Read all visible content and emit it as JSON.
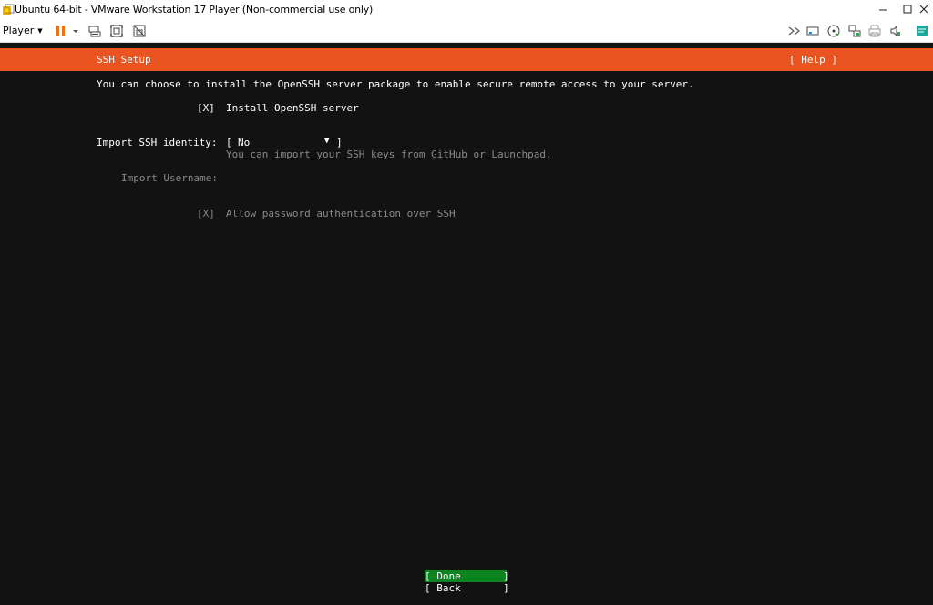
{
  "window": {
    "title": "Ubuntu 64-bit - VMware Workstation 17 Player (Non-commercial use only)",
    "minimize_icon": "minimize-icon",
    "maximize_icon": "maximize-icon",
    "close_icon": "close-icon"
  },
  "toolbar": {
    "player_label": "Player",
    "icons": [
      "pause-icon",
      "dropdown-icon",
      "send-ctrl-alt-del-icon",
      "fit-guest-icon",
      "unity-icon",
      "forward-icon",
      "removable-device-icon",
      "cd-dvd-icon",
      "network-icon",
      "printer-icon",
      "sound-icon",
      "message-log-icon"
    ]
  },
  "screen": {
    "header_title": "SSH Setup",
    "help_label": "[ Help ]",
    "description": "You can choose to install the OpenSSH server package to enable secure remote access to your server.",
    "install_checkbox": "[X]",
    "install_label": "Install OpenSSH server",
    "import_label": "Import SSH identity:",
    "import_select_open": "[",
    "import_value": "No",
    "import_arrow": "▼",
    "import_select_close": "]",
    "import_help": "You can import your SSH keys from GitHub or Launchpad.",
    "username_label": "Import Username:",
    "password_checkbox": "[X]",
    "password_label": "Allow password authentication over SSH",
    "done_button": "[ Done       ]",
    "back_button": "[ Back       ]"
  },
  "colors": {
    "header_orange": "#e95420",
    "done_green": "#0e8420",
    "background": "#121212",
    "disabled_text": "#8a8a8a"
  }
}
